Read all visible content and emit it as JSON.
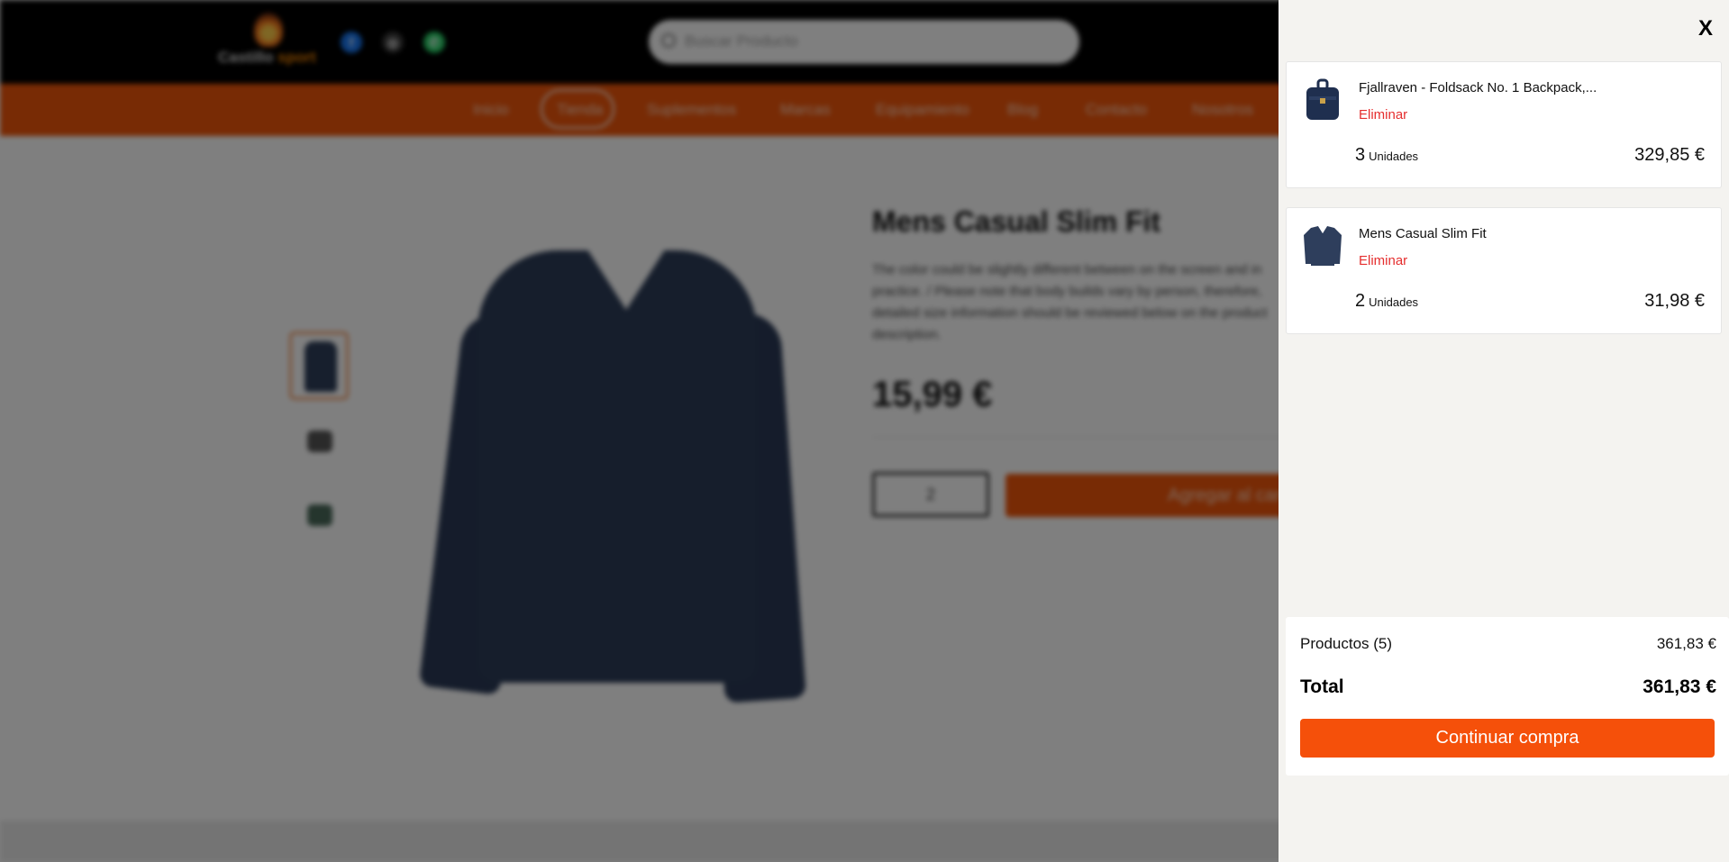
{
  "header": {
    "logo": {
      "word1": "Castillo",
      "word2": "sport"
    },
    "social": [
      {
        "icon": "facebook-icon",
        "glyph": "f",
        "color": "#1877f2"
      },
      {
        "icon": "instagram-icon",
        "glyph": "◎",
        "color": "#3a3a3a"
      },
      {
        "icon": "whatsapp-icon",
        "glyph": "✆",
        "color": "#25d366"
      }
    ],
    "search_placeholder": "Buscar Producto"
  },
  "nav": {
    "items": [
      "Inicio",
      "Tienda",
      "Suplementos",
      "Marcas",
      "Equipamiento",
      "Blog",
      "Contacto",
      "Nosotros"
    ],
    "active": "Tienda"
  },
  "product": {
    "title": "Mens Casual Slim Fit",
    "description": "The color could be slightly different between on the screen and in practice. / Please note that body builds vary by person, therefore, detailed size information should be reviewed below on the product description.",
    "price": "15,99 €",
    "quantity": "2",
    "add_button": "Agregar al carrito"
  },
  "cart": {
    "close_label": "X",
    "items": [
      {
        "name": "Fjallraven - Foldsack No. 1 Backpack,...",
        "remove": "Eliminar",
        "qty": "3",
        "unit": "Unidades",
        "price": "329,85 €"
      },
      {
        "name": "Mens Casual Slim Fit",
        "remove": "Eliminar",
        "qty": "2",
        "unit": "Unidades",
        "price": "31,98 €"
      }
    ],
    "summary": {
      "products_label": "Productos (5)",
      "products_value": "361,83 €",
      "total_label": "Total",
      "total_value": "361,83 €",
      "continue_label": "Continuar compra"
    }
  },
  "colors": {
    "accent": "#f5500a",
    "remove": "#e52e2e",
    "drawer_bg": "#f4f3f0"
  }
}
